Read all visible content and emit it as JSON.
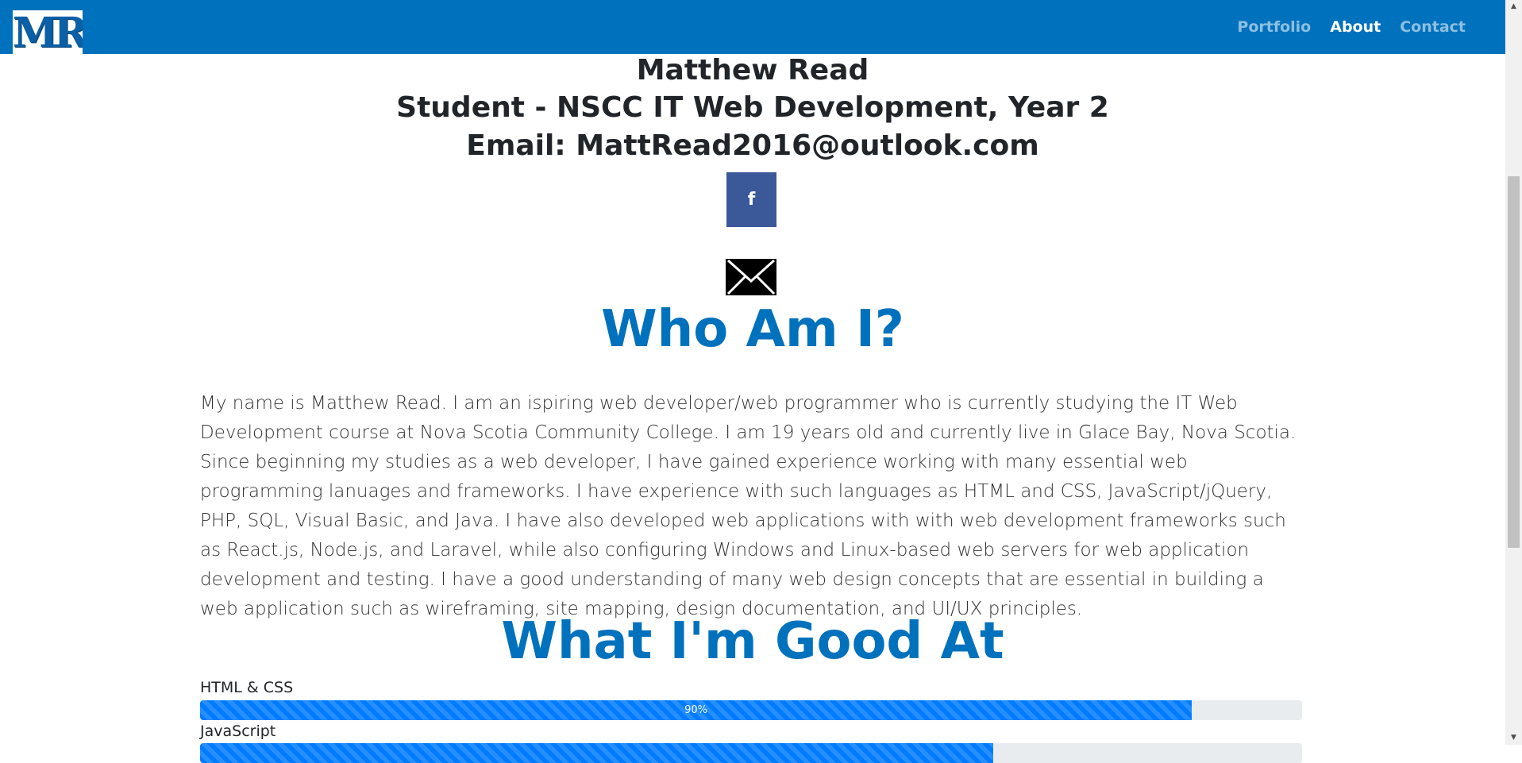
{
  "navbar": {
    "logo_text": "MR",
    "links": [
      {
        "label": "Portfolio",
        "active": false
      },
      {
        "label": "About",
        "active": true
      },
      {
        "label": "Contact",
        "active": false
      }
    ],
    "background_color": "#0071bc"
  },
  "profile": {
    "name": "Matthew Read",
    "title": "Student - NSCC IT Web Development, Year 2",
    "email_line": "Email: MattRead2016@outlook.com",
    "facebook_icon": "f",
    "facebook_color": "#3b5998",
    "mail_icon": "envelope-icon"
  },
  "about": {
    "heading": "Who Am I?",
    "bio": "My name is Matthew Read. I am an ispiring web developer/web programmer who is currently studying the IT Web Development course at Nova Scotia Community College. I am 19 years old and currently live in Glace Bay, Nova Scotia. Since beginning my studies as a web developer, I have gained experience working with many essential web programming lanuages and frameworks. I have experience with such languages as HTML and CSS, JavaScript/jQuery, PHP, SQL, Visual Basic, and Java. I have also developed web applications with with web development frameworks such as React.js, Node.js, and Laravel, while also configuring Windows and Linux-based web servers for web application development and testing. I have a good understanding of many web design concepts that are essential in building a web application such as wireframing, site mapping, design documentation, and UI/UX principles."
  },
  "skills": {
    "heading": "What I'm Good At",
    "items": [
      {
        "label": "HTML & CSS",
        "percent": 90,
        "percent_label": "90%"
      },
      {
        "label": "JavaScript",
        "percent": null,
        "percent_label": ""
      }
    ],
    "bar_color": "#007bff"
  }
}
